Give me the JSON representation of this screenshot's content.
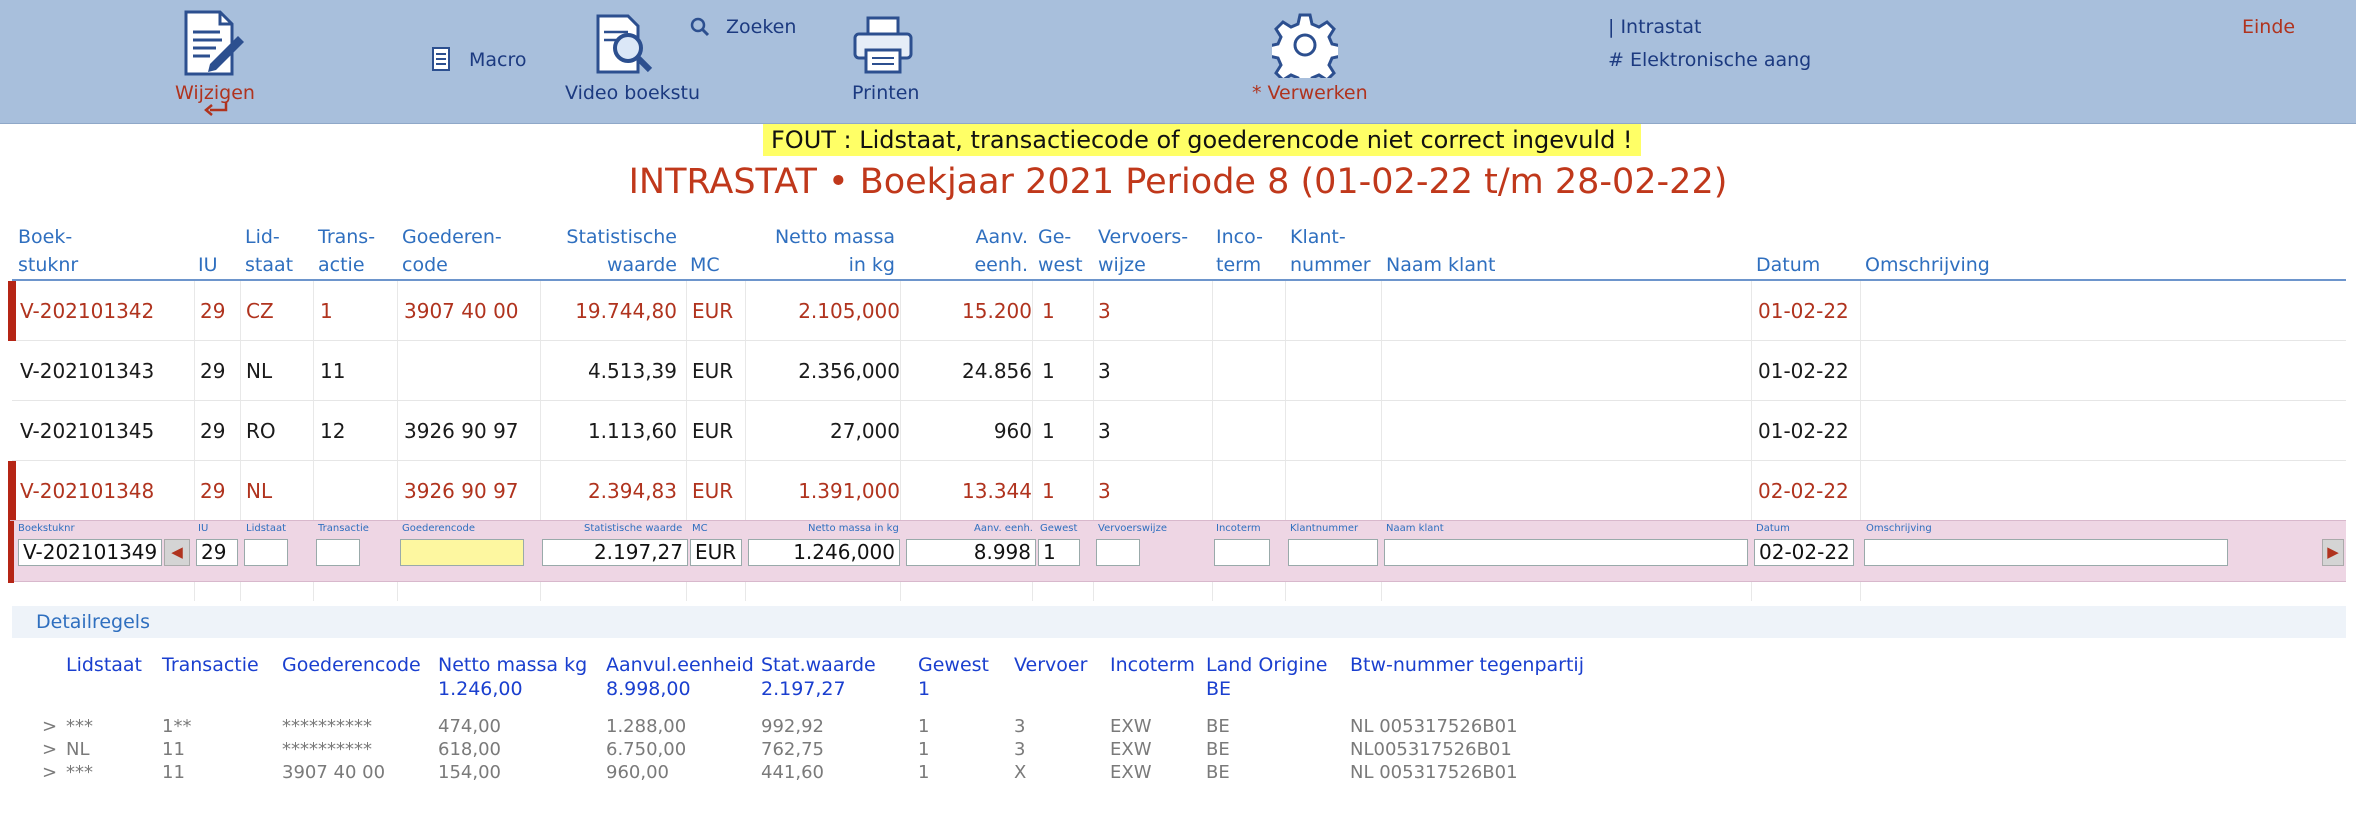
{
  "toolbar": {
    "wijzigen": "Wijzigen",
    "macro": "Macro",
    "video": "Video boekstu",
    "zoeken": "Zoeken",
    "printen": "Printen",
    "verwerken": "* Verwerken",
    "intrastat": "| Intrastat",
    "elektronische": "# Elektronische aangifte",
    "einde": "Einde"
  },
  "error_message": "FOUT : Lidstaat, transactiecode of goederencode niet correct ingevuld  !",
  "page_title": "INTRASTAT  •  Boekjaar 2021 Periode 8 (01-02-22 t/m 28-02-22)",
  "columns": {
    "boekstuknr": "Boek-\nstuknr",
    "iu": "\nIU",
    "lidstaat": "Lid-\nstaat",
    "transactie": "Trans-\nactie",
    "goederencode": "Goederen-\ncode",
    "stat_waarde": "Statistische\nwaarde",
    "mc": "\nMC",
    "netto": "Netto massa\nin kg",
    "aanv": "Aanv.\neenh.",
    "gewest": "Ge-\nwest",
    "vervoer": "Vervoers-\nwijze",
    "incoterm": "Inco-\nterm",
    "klantnr": "Klant-\nnummer",
    "naam": "\nNaam klant",
    "datum": "\nDatum",
    "omschrijving": "\nOmschrijving"
  },
  "rows": [
    {
      "boekstuknr": "V-202101342",
      "iu": "29",
      "lidstaat": "CZ",
      "transactie": "1",
      "goederencode": "3907 40 00",
      "stat_waarde": "19.744,80",
      "mc": "EUR",
      "netto": "2.105,000",
      "aanv": "15.200",
      "gewest": "1",
      "vervoer": "3",
      "datum": "01-02-22",
      "error": true
    },
    {
      "boekstuknr": "V-202101343",
      "iu": "29",
      "lidstaat": "NL",
      "transactie": "11",
      "goederencode": "",
      "stat_waarde": "4.513,39",
      "mc": "EUR",
      "netto": "2.356,000",
      "aanv": "24.856",
      "gewest": "1",
      "vervoer": "3",
      "datum": "01-02-22",
      "error": false
    },
    {
      "boekstuknr": "V-202101345",
      "iu": "29",
      "lidstaat": "RO",
      "transactie": "12",
      "goederencode": "3926 90 97",
      "stat_waarde": "1.113,60",
      "mc": "EUR",
      "netto": "27,000",
      "aanv": "960",
      "gewest": "1",
      "vervoer": "3",
      "datum": "01-02-22",
      "error": false
    },
    {
      "boekstuknr": "V-202101348",
      "iu": "29",
      "lidstaat": "NL",
      "transactie": "",
      "goederencode": "3926 90 97",
      "stat_waarde": "2.394,83",
      "mc": "EUR",
      "netto": "1.391,000",
      "aanv": "13.344",
      "gewest": "1",
      "vervoer": "3",
      "datum": "02-02-22",
      "error": true
    }
  ],
  "edit_row": {
    "labels": {
      "boekstuknr": "Boekstuknr",
      "iu": "IU",
      "lidstaat": "Lidstaat",
      "transactie": "Transactie",
      "goederencode": "Goederencode",
      "stat_waarde": "Statistische waarde",
      "mc": "MC",
      "netto": "Netto massa in kg",
      "aanv": "Aanv. eenh.",
      "gewest": "Gewest",
      "vervoer": "Vervoerswijze",
      "incoterm": "Incoterm",
      "klantnr": "Klantnummer",
      "naam": "Naam klant",
      "datum": "Datum",
      "omschrijving": "Omschrijving"
    },
    "values": {
      "boekstuknr": "V-202101349",
      "iu": "29",
      "lidstaat": "",
      "transactie": "",
      "goederencode": "",
      "stat_waarde": "2.197,27",
      "mc": "EUR",
      "netto": "1.246,000",
      "aanv": "8.998",
      "gewest": "1",
      "vervoer": "",
      "incoterm": "",
      "klantnr": "",
      "naam": "",
      "datum": "02-02-22",
      "omschrijving": ""
    }
  },
  "detail": {
    "title": "Detailregels",
    "headers": {
      "lidstaat": "Lidstaat",
      "transactie": "Transactie",
      "goederencode": "Goederencode",
      "netto": "Netto massa kg",
      "aanvul": "Aanvul.eenheid",
      "stat": "Stat.waarde",
      "gewest": "Gewest",
      "vervoer": "Vervoer",
      "incoterm": "Incoterm",
      "land": "Land Origine",
      "btw": "Btw-nummer tegenpartij"
    },
    "totals": {
      "netto": "1.246,00",
      "aanvul": "8.998,00",
      "stat": "2.197,27",
      "gewest": "1",
      "land": "BE"
    },
    "rows": [
      {
        "arrow": ">",
        "lidstaat": "***",
        "transactie": "1**",
        "goederencode": "**********",
        "netto": "474,00",
        "aanvul": "1.288,00",
        "stat": "992,92",
        "gewest": "1",
        "vervoer": "3",
        "incoterm": "EXW",
        "land": "BE",
        "btw": "NL 005317526B01"
      },
      {
        "arrow": ">",
        "lidstaat": "NL",
        "transactie": "11",
        "goederencode": "**********",
        "netto": "618,00",
        "aanvul": "6.750,00",
        "stat": "762,75",
        "gewest": "1",
        "vervoer": "3",
        "incoterm": "EXW",
        "land": "BE",
        "btw": "NL005317526B01"
      },
      {
        "arrow": ">",
        "lidstaat": "***",
        "transactie": "11",
        "goederencode": "3907 40 00",
        "netto": "154,00",
        "aanvul": "960,00",
        "stat": "441,60",
        "gewest": "1",
        "vervoer": "X",
        "incoterm": "EXW",
        "land": "BE",
        "btw": "NL 005317526B01"
      }
    ]
  },
  "colors": {
    "toolbar_bg": "#a8bfdc",
    "accent_red": "#b0331e",
    "header_blue": "#2f6fbf",
    "error_yellow": "#ffff66",
    "edit_row_bg": "#eed6e4"
  }
}
